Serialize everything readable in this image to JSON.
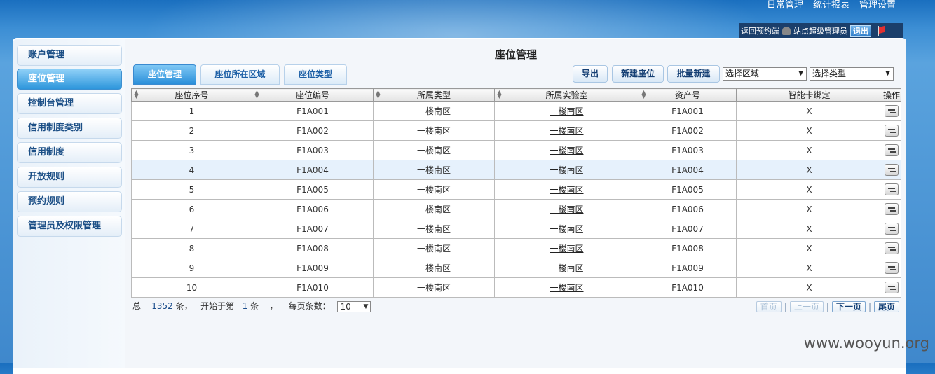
{
  "top_nav": [
    "日常管理",
    "统计报表",
    "管理设置"
  ],
  "user_bar": {
    "back_label": "返回预约端",
    "user_label": "站点超级管理员",
    "logout_label": "退出"
  },
  "sidebar": {
    "items": [
      {
        "label": "账户管理",
        "active": false
      },
      {
        "label": "座位管理",
        "active": true
      },
      {
        "label": "控制台管理",
        "active": false
      },
      {
        "label": "信用制度类别",
        "active": false
      },
      {
        "label": "信用制度",
        "active": false
      },
      {
        "label": "开放规则",
        "active": false
      },
      {
        "label": "预约规则",
        "active": false
      },
      {
        "label": "管理员及权限管理",
        "active": false
      }
    ]
  },
  "main": {
    "title": "座位管理",
    "tabs": [
      {
        "label": "座位管理",
        "active": true
      },
      {
        "label": "座位所在区域",
        "active": false
      },
      {
        "label": "座位类型",
        "active": false
      }
    ],
    "toolbar": {
      "export_label": "导出",
      "new_seat_label": "新建座位",
      "batch_new_label": "批量新建",
      "area_select": "选择区域",
      "type_select": "选择类型"
    },
    "table": {
      "headers": [
        "座位序号",
        "座位编号",
        "所属类型",
        "所属实验室",
        "资产号",
        "智能卡绑定",
        "操作"
      ],
      "rows": [
        [
          "1",
          "F1A001",
          "一楼南区",
          "一楼南区",
          "F1A001",
          "X"
        ],
        [
          "2",
          "F1A002",
          "一楼南区",
          "一楼南区",
          "F1A002",
          "X"
        ],
        [
          "3",
          "F1A003",
          "一楼南区",
          "一楼南区",
          "F1A003",
          "X"
        ],
        [
          "4",
          "F1A004",
          "一楼南区",
          "一楼南区",
          "F1A004",
          "X"
        ],
        [
          "5",
          "F1A005",
          "一楼南区",
          "一楼南区",
          "F1A005",
          "X"
        ],
        [
          "6",
          "F1A006",
          "一楼南区",
          "一楼南区",
          "F1A006",
          "X"
        ],
        [
          "7",
          "F1A007",
          "一楼南区",
          "一楼南区",
          "F1A007",
          "X"
        ],
        [
          "8",
          "F1A008",
          "一楼南区",
          "一楼南区",
          "F1A008",
          "X"
        ],
        [
          "9",
          "F1A009",
          "一楼南区",
          "一楼南区",
          "F1A009",
          "X"
        ],
        [
          "10",
          "F1A010",
          "一楼南区",
          "一楼南区",
          "F1A010",
          "X"
        ]
      ],
      "highlighted_row": 4
    },
    "footer": {
      "total_prefix": "总",
      "total": "1352",
      "total_suffix": "条，",
      "start_prefix": "开始于第",
      "start": "1",
      "start_suffix": "条",
      "comma": "，",
      "per_page_label": "每页条数：",
      "per_page": "10"
    },
    "pager": {
      "first": "首页",
      "prev": "上一页",
      "next": "下一页",
      "last": "尾页",
      "separator": "|"
    }
  },
  "watermark": "www.wooyun.org",
  "icons": [
    "user-icon",
    "flag-icon",
    "sort-icon",
    "edit-icon",
    "dropdown-arrow-icon"
  ]
}
